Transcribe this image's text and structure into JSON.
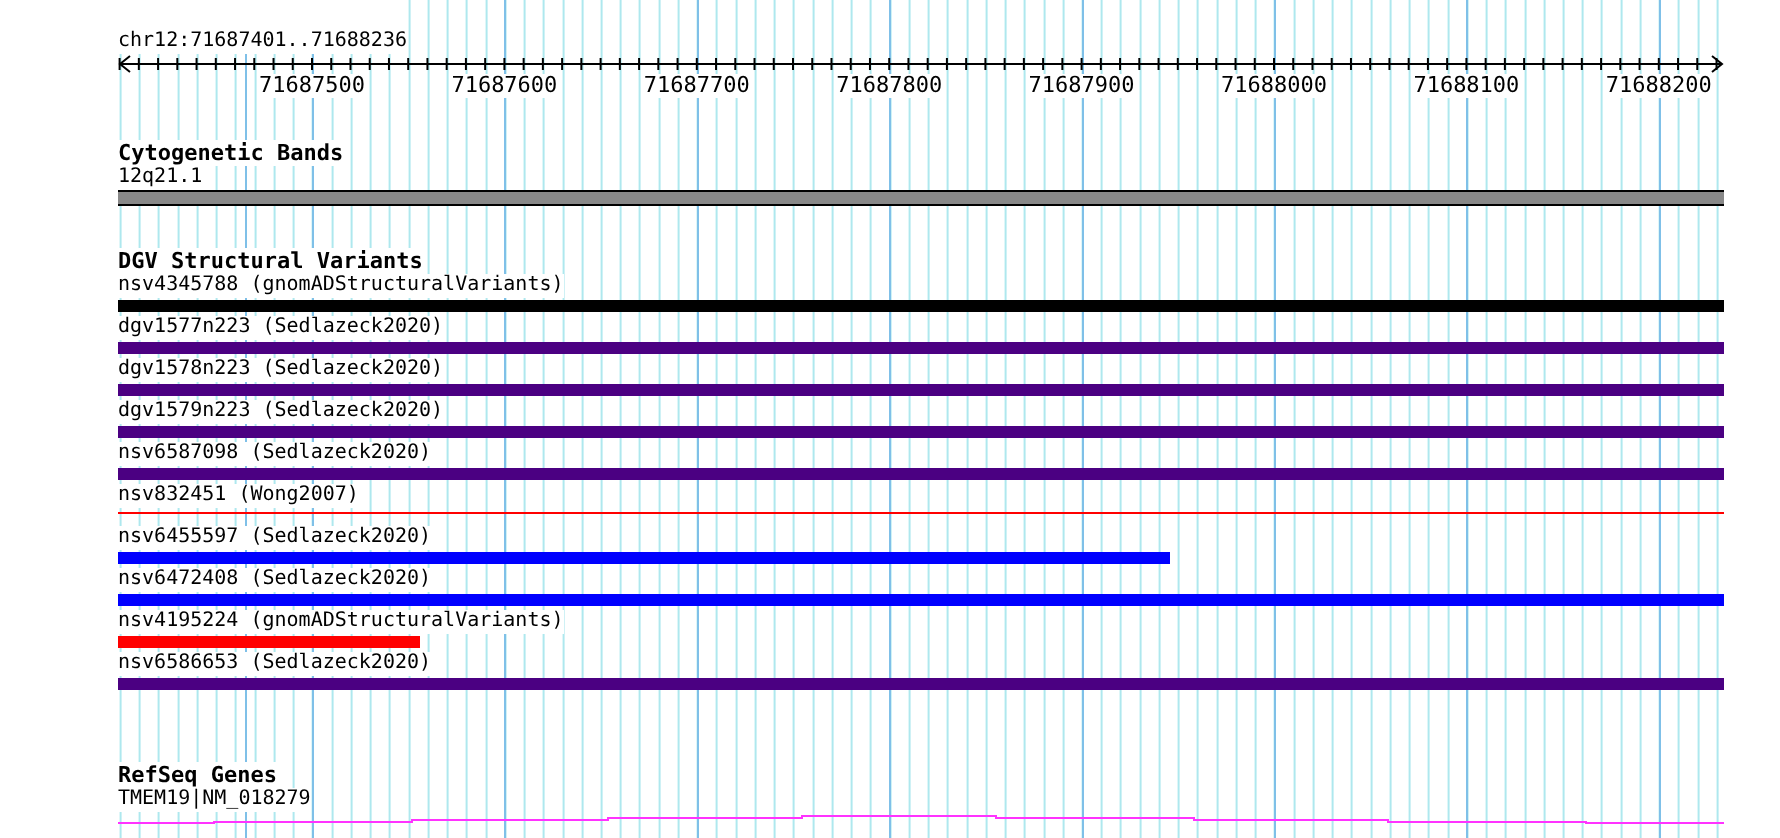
{
  "location": "chr12:71687401..71688236",
  "ruler": {
    "ticks": [
      "71687500",
      "71687600",
      "71687700",
      "71687800",
      "71687900",
      "71688000",
      "71688100",
      "71688200"
    ]
  },
  "cytogenetic": {
    "title": "Cytogenetic Bands",
    "band": "12q21.1"
  },
  "dgv": {
    "title": "DGV Structural Variants",
    "variants": [
      {
        "label": "nsv4345788 (gnomADStructuralVariants)",
        "color": "#000000",
        "kind": "bar",
        "level": 1
      },
      {
        "label": "dgv1577n223 (Sedlazeck2020)",
        "color": "#4b0082",
        "kind": "bar",
        "level": 1
      },
      {
        "label": "dgv1578n223 (Sedlazeck2020)",
        "color": "#4b0082",
        "kind": "bar",
        "level": 1
      },
      {
        "label": "dgv1579n223 (Sedlazeck2020)",
        "color": "#4b0082",
        "kind": "bar",
        "level": 1
      },
      {
        "label": "nsv6587098 (Sedlazeck2020)",
        "color": "#4b0082",
        "kind": "bar",
        "level": 1
      },
      {
        "label": "nsv832451 (Wong2007)",
        "color": "#ff0000",
        "kind": "line",
        "level": 1
      },
      {
        "label": "nsv6455597 (Sedlazeck2020)",
        "color": "#0000ff",
        "kind": "bar",
        "level": 0.655
      },
      {
        "label": "nsv6472408 (Sedlazeck2020)",
        "color": "#0000ff",
        "kind": "bar",
        "level": 1
      },
      {
        "label": "nsv4195224 (gnomADStructuralVariants)",
        "color": "#ff0000",
        "kind": "bar",
        "level": 0.188
      },
      {
        "label": "nsv6586653 (Sedlazeck2020)",
        "color": "#4b0082",
        "kind": "bar",
        "level": 1
      }
    ]
  },
  "refseq": {
    "title": "RefSeq Genes",
    "gene": "TMEM19|NM_018279"
  }
}
